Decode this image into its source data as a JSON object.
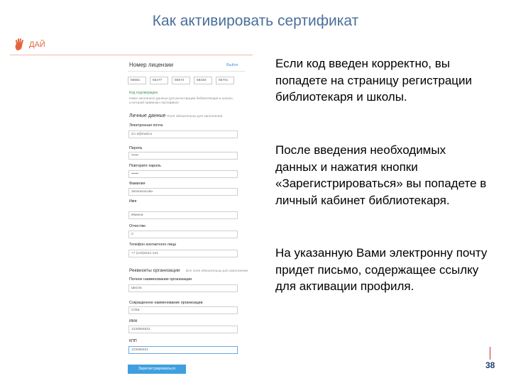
{
  "slide": {
    "title": "Как активировать сертификат",
    "page_number": "38"
  },
  "screenshot": {
    "logo_text": "ДАЙ",
    "license_section": {
      "title": "Номер лицензии",
      "link": "Выйти",
      "codes": [
        "55551",
        "55477",
        "55574",
        "58183",
        "55741"
      ],
      "status": "Код подтвержден",
      "note": "Ниже заполните данные для регистрации библиотекаря и школы, к которой привязан сертификат"
    },
    "personal_section": {
      "title": "Личные данные",
      "hint": "Поля обязательны для заполнения",
      "fields": [
        {
          "label": "Электронная почта",
          "value": "d.c.s@mail.ru"
        },
        {
          "label": "Пароль",
          "value": "••••••"
        },
        {
          "label": "Повторите пароль",
          "value": "••••••"
        },
        {
          "label": "Фамилия",
          "value": "Загальтисова"
        },
        {
          "label": "Имя",
          "value": "Иванна"
        },
        {
          "label": "Отчество",
          "value": "С"
        },
        {
          "label": "Телефон контактного лица",
          "value": "+7 (123)4211-121"
        }
      ]
    },
    "org_section": {
      "title": "Реквизиты организации",
      "hint": "Все поля обязательны для заполнения",
      "fields": [
        {
          "label": "Полное наименование организации",
          "value": "Школа"
        },
        {
          "label": "Сокращенное наименование организации",
          "value": "СОШ"
        },
        {
          "label": "ИНН",
          "value": "1234564521"
        },
        {
          "label": "КПП",
          "value": "123456421"
        }
      ]
    },
    "submit_label": "Зарегистрироваться"
  },
  "paragraphs": [
    "Если код введен корректно, вы попадете на страницу регистрации библиотекаря и школы.",
    "После введения необходимых данных и нажатия кнопки «Зарегистрироваться» вы попадете в личный кабинет библиотекаря.",
    "На указанную Вами электронну почту придет письмо, содержащее ссылку для активации профиля."
  ],
  "colors": {
    "title": "#4a6f9a",
    "logo": "#e2643d",
    "button": "#3f9fe0",
    "page_number": "#1f3e6e"
  },
  "icons": [
    "hand-logo-icon"
  ]
}
